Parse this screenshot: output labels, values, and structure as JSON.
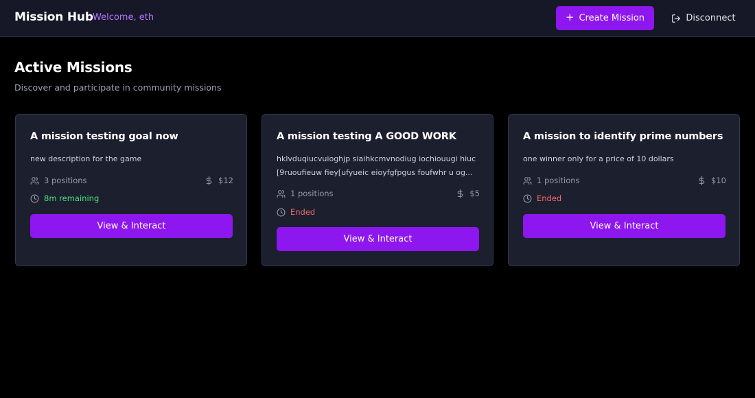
{
  "header": {
    "brand": "Mission Hub",
    "welcome": "Welcome, eth",
    "create_label": "Create Mission",
    "disconnect_label": "Disconnect"
  },
  "main": {
    "title": "Active Missions",
    "subtitle": "Discover and participate in community missions"
  },
  "missions": [
    {
      "title": "A mission testing goal now",
      "description": "new description for the game",
      "positions": "3 positions",
      "reward": "$12",
      "status": "8m remaining",
      "status_type": "active",
      "button_label": "View & Interact"
    },
    {
      "title": "A mission testing A GOOD WORK",
      "description": "hklvduqiucvuioghjp siaihkcmvnodiug iochiouugi hiuc [9ruoufieuw fiey[ufyueic eioyfgfpgus foufwhr u og...",
      "positions": "1 positions",
      "reward": "$5",
      "status": "Ended",
      "status_type": "ended",
      "button_label": "View & Interact"
    },
    {
      "title": "A mission to identify prime numbers",
      "description": "one winner only for a price of 10 dollars",
      "positions": "1 positions",
      "reward": "$10",
      "status": "Ended",
      "status_type": "ended",
      "button_label": "View & Interact"
    }
  ],
  "icons": {
    "create": "plus-icon",
    "disconnect": "logout-icon",
    "positions": "users-icon",
    "reward": "dollar-icon",
    "status": "clock-icon"
  },
  "colors": {
    "accent": "#8d17ee",
    "welcome": "#b574ff",
    "active": "#4ade80",
    "ended": "#f06a6a"
  }
}
